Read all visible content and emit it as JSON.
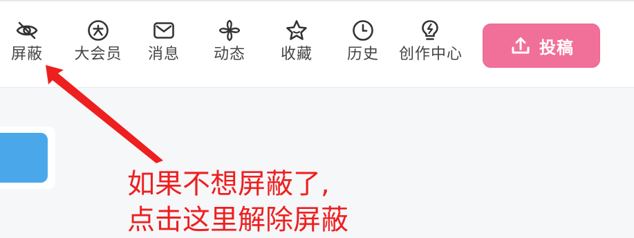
{
  "nav": {
    "items": [
      {
        "label": "屏蔽",
        "icon": "eye-off-icon"
      },
      {
        "label": "大会员",
        "icon": "big-member-icon"
      },
      {
        "label": "消息",
        "icon": "mail-icon"
      },
      {
        "label": "动态",
        "icon": "windmill-icon"
      },
      {
        "label": "收藏",
        "icon": "star-icon"
      },
      {
        "label": "历史",
        "icon": "clock-icon"
      },
      {
        "label": "创作中心",
        "icon": "lightbulb-icon"
      }
    ],
    "upload_label": "投稿",
    "upload_icon": "upload-icon"
  },
  "annotation": {
    "line1": "如果不想屏蔽了,",
    "line2": "点击这里解除屏蔽"
  },
  "colors": {
    "accent_pink": "#f0709a",
    "annotation_red": "#ee1f1f",
    "blue_button": "#4aa8ea"
  }
}
